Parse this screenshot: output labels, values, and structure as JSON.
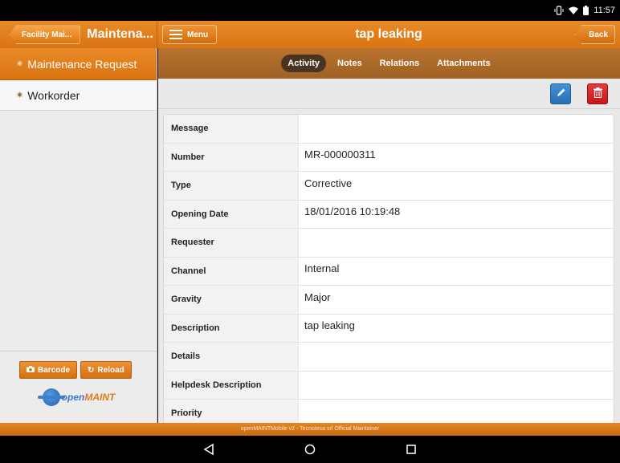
{
  "status_bar": {
    "time": "11:57",
    "icons": [
      "vibrate-icon",
      "wifi-icon",
      "battery-icon"
    ]
  },
  "header": {
    "breadcrumb_label": "Facility Mai...",
    "section_title": "Maintena...",
    "menu_label": "Menu",
    "title": "tap leaking",
    "back_label": "Back"
  },
  "sidebar": {
    "items": [
      {
        "label": "Maintenance Request",
        "active": true
      },
      {
        "label": "Workorder",
        "active": false
      }
    ],
    "barcode_label": "Barcode",
    "reload_label": "Reload",
    "logo_prefix": "open",
    "logo_suffix": "MAINT"
  },
  "tabs": [
    {
      "label": "Activity",
      "active": true
    },
    {
      "label": "Notes",
      "active": false
    },
    {
      "label": "Relations",
      "active": false
    },
    {
      "label": "Attachments",
      "active": false
    }
  ],
  "fields": [
    {
      "label": "Message",
      "value": ""
    },
    {
      "label": "Number",
      "value": "MR-000000311"
    },
    {
      "label": "Type",
      "value": "Corrective"
    },
    {
      "label": "Opening Date",
      "value": "18/01/2016 10:19:48"
    },
    {
      "label": "Requester",
      "value": ""
    },
    {
      "label": "Channel",
      "value": "Internal"
    },
    {
      "label": "Gravity",
      "value": "Major"
    },
    {
      "label": "Description",
      "value": "tap leaking"
    },
    {
      "label": "Details",
      "value": ""
    },
    {
      "label": "Helpdesk Description",
      "value": ""
    },
    {
      "label": "Priority",
      "value": ""
    }
  ],
  "footer": {
    "text": "openMAINTMobile v2 - Tecnoteca srl Official Maintainer"
  },
  "colors": {
    "accent": "#e07e1c",
    "tab_active": "#4a3320",
    "edit": "#2f7cc6",
    "delete": "#d42020"
  }
}
